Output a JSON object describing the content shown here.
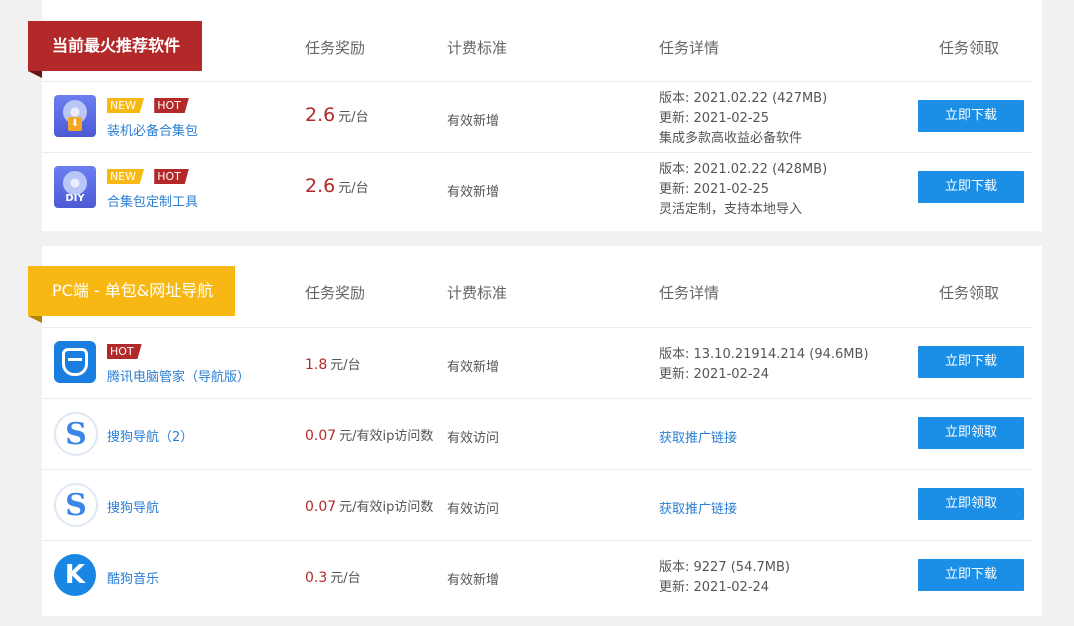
{
  "sections": [
    {
      "title": "当前最火推荐软件",
      "col_reward": "任务奖励",
      "col_billing": "计费标准",
      "col_detail": "任务详情",
      "col_claim": "任务领取",
      "rows": [
        {
          "icon": "install-package-icon",
          "tag_new": "NEW",
          "tag_hot": "HOT",
          "name": "装机必备合集包",
          "reward": "2.6",
          "unit": "元/台",
          "billing": "有效新增",
          "detail": [
            "版本: 2021.02.22 (427MB)",
            "更新:  2021-02-25",
            "集成多款高收益必备软件"
          ],
          "button": "立即下载"
        },
        {
          "icon": "diy-package-icon",
          "diy_label": "DIY",
          "tag_new": "NEW",
          "tag_hot": "HOT",
          "name": "合集包定制工具",
          "reward": "2.6",
          "unit": "元/台",
          "billing": "有效新增",
          "detail": [
            "版本: 2021.02.22 (428MB)",
            "更新:  2021-02-25",
            "灵活定制，支持本地导入"
          ],
          "button": "立即下载"
        }
      ]
    },
    {
      "title": "PC端 - 单包&网址导航",
      "col_reward": "任务奖励",
      "col_billing": "计费标准",
      "col_detail": "任务详情",
      "col_claim": "任务领取",
      "rows": [
        {
          "icon": "tencent-pc-manager-icon",
          "tag_hot": "HOT",
          "name": "腾讯电脑管家（导航版）",
          "reward": "1.8",
          "unit": "元/台",
          "billing": "有效新增",
          "detail": [
            "版本: 13.10.21914.214 (94.6MB)",
            "更新:  2021-02-24"
          ],
          "button": "立即下载"
        },
        {
          "icon": "sogou-icon",
          "glyph": "S",
          "name": "搜狗导航（2）",
          "reward": "0.07",
          "unit": "元/有效ip访问数",
          "billing": "有效访问",
          "detail_link": "获取推广链接",
          "button": "立即领取"
        },
        {
          "icon": "sogou-icon",
          "glyph": "S",
          "name": "搜狗导航",
          "reward": "0.07",
          "unit": "元/有效ip访问数",
          "billing": "有效访问",
          "detail_link": "获取推广链接",
          "button": "立即领取"
        },
        {
          "icon": "kugou-music-icon",
          "glyph": "K",
          "name": "酷狗音乐",
          "reward": "0.3",
          "unit": "元/台",
          "billing": "有效新增",
          "detail": [
            "版本: 9227 (54.7MB)",
            "更新:  2021-02-24"
          ],
          "button": "立即下载"
        }
      ]
    }
  ],
  "colors": {
    "red_badge": "#b32828",
    "yellow_badge": "#f7b814",
    "button_blue": "#1b8fe6",
    "link_blue": "#2b7fd4"
  }
}
